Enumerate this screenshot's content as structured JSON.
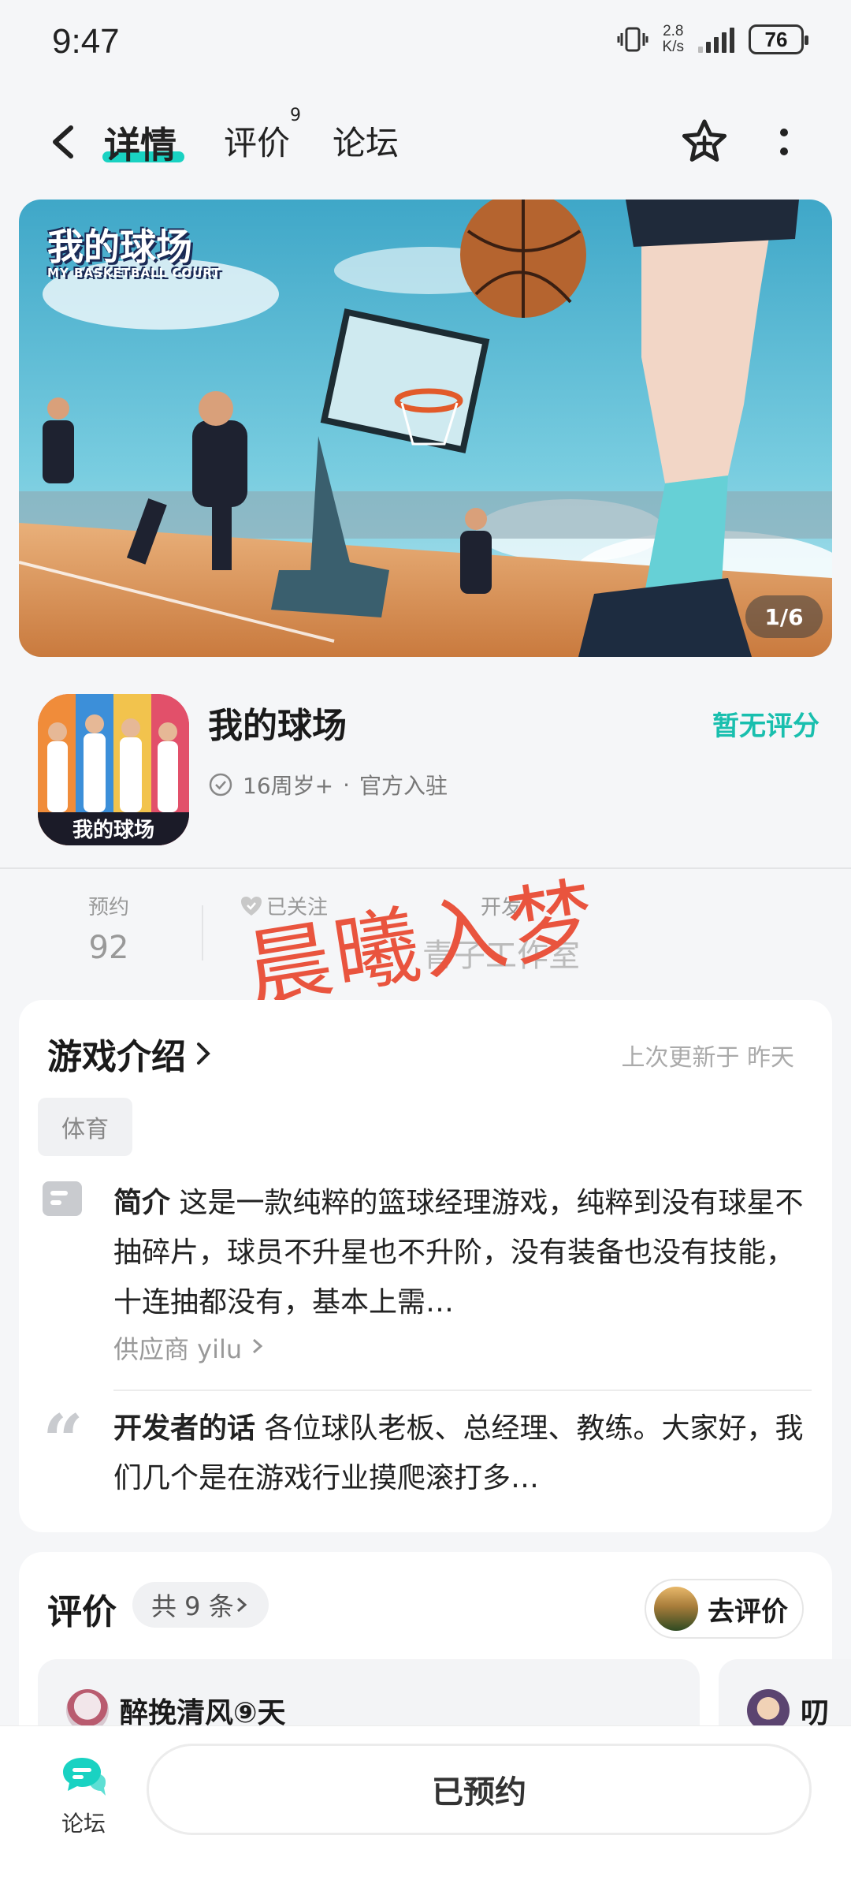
{
  "status_bar": {
    "time": "9:47",
    "net_speed_value": "2.8",
    "net_speed_unit": "K/s",
    "battery": "76"
  },
  "header": {
    "tabs": [
      {
        "label": "详情",
        "active": true
      },
      {
        "label": "评价",
        "badge": "9"
      },
      {
        "label": "论坛"
      }
    ],
    "icons": [
      "back-icon",
      "star-add-icon",
      "more-icon"
    ]
  },
  "banner": {
    "logo_text": "我的球场",
    "logo_sub": "MY BASKETBALL COURT",
    "page_indicator": "1/6"
  },
  "app": {
    "name": "我的球场",
    "rating_text": "暂无评分",
    "age": "16周岁+",
    "separator": "·",
    "official": "官方入驻"
  },
  "stats": {
    "reserve_label": "预约",
    "reserve_value": "92",
    "follow_label": "已关注",
    "dev_label": "开发",
    "dev_value": "青子工作室",
    "watermark": "晨曦入梦"
  },
  "intro": {
    "title": "游戏介绍",
    "updated": "上次更新于 昨天",
    "tag": "体育",
    "summary_label": "简介",
    "summary_text": "这是一款纯粹的篮球经理游戏，纯粹到没有球星不抽碎片，球员不升星也不升阶，没有装备也没有技能，十连抽都没有，基本上需…",
    "supplier": "供应商 yilu",
    "dev_words_label": "开发者的话",
    "dev_words_text": "各位球队老板、总经理、教练。大家好，我们几个是在游戏行业摸爬滚打多…"
  },
  "reviews": {
    "title": "评价",
    "count": "共 9 条",
    "write_button": "去评价",
    "items": [
      {
        "user": "醉挽清风⑨天"
      },
      {
        "user": "叨"
      }
    ]
  },
  "bottom": {
    "forum_label": "论坛",
    "reserved_button": "已预约"
  },
  "colors": {
    "accent": "#19d2c2",
    "rating": "#19bfae",
    "watermark": "#e9543e"
  }
}
